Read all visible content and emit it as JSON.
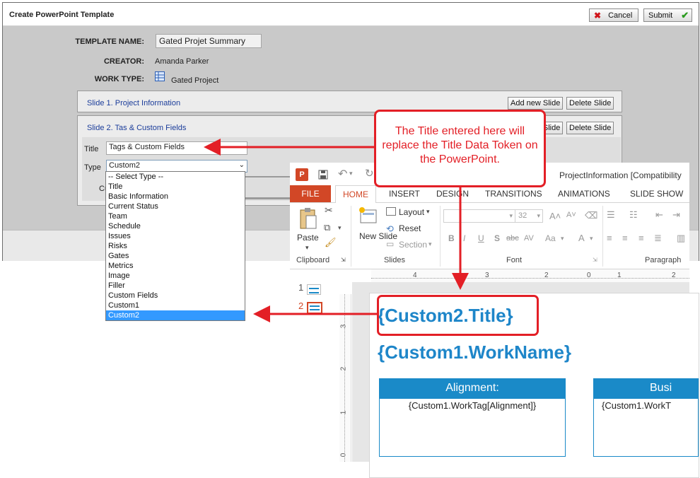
{
  "web_form": {
    "window_title": "Create PowerPoint Template",
    "cancel_label": "Cancel",
    "submit_label": "Submit",
    "template_name_label": "TEMPLATE NAME:",
    "template_name_value": "Gated Projet Summary",
    "creator_label": "CREATOR:",
    "creator_value": "Amanda Parker",
    "work_type_label": "WORK TYPE:",
    "work_type_value": "Gated Project",
    "slides": [
      {
        "title": "Slide 1. Project Information",
        "add_label": "Add new Slide",
        "delete_label": "Delete Slide"
      },
      {
        "title": "Slide 2. Tas & Custom Fields",
        "add_label": "Add new Slide",
        "delete_label": "Delete Slide"
      }
    ],
    "title_field_label": "Title",
    "title_field_value": "Tags & Custom Fields",
    "type_field_label": "Type",
    "type_field_value": "Custom2",
    "partial_label": "Cu",
    "type_options": [
      "-- Select Type --",
      "Title",
      "Basic Information",
      "Current Status",
      "Team",
      "Schedule",
      "Issues",
      "Risks",
      "Gates",
      "Metrics",
      "Image",
      "Filler",
      "Custom Fields",
      "Custom1",
      "Custom2"
    ],
    "selected_option": "Custom2"
  },
  "powerpoint": {
    "doc_title": "ProjectInformation [Compatibility",
    "tabs": [
      "FILE",
      "HOME",
      "INSERT",
      "DESIGN",
      "TRANSITIONS",
      "ANIMATIONS",
      "SLIDE SHOW"
    ],
    "active_tab": "HOME",
    "clipboard": {
      "paste_label": "Paste",
      "group_label": "Clipboard"
    },
    "slides_group": {
      "new_slide_label": "New Slide",
      "layout_label": "Layout",
      "reset_label": "Reset",
      "section_label": "Section",
      "group_label": "Slides"
    },
    "font_group": {
      "font_size": "32",
      "group_label": "Font"
    },
    "paragraph_group": {
      "group_label": "Paragraph"
    },
    "ruler_ticks": [
      "4",
      "3",
      "2",
      "1",
      "0",
      "1",
      "2"
    ],
    "vruler_ticks": [
      "3",
      "2",
      "1",
      "0"
    ],
    "thumbnail_numbers": [
      "1",
      "2"
    ],
    "slide": {
      "title_token": "{Custom2.Title}",
      "workname_token": "{Custom1.WorkName}",
      "table1_header": "Alignment:",
      "table1_body": "{Custom1.WorkTag[Alignment]}",
      "table2_header": "Busi",
      "table2_body": "{Custom1.WorkT"
    }
  },
  "callout": {
    "text": "The Title entered here will replace the Title Data Token on the PowerPoint.",
    "color": "#e31f26"
  },
  "colors": {
    "ppt_accent": "#d24726",
    "token_blue": "#1e86c9",
    "table_blue": "#1a8ac8",
    "callout_red": "#e31f26",
    "selection_blue": "#3399ff"
  }
}
